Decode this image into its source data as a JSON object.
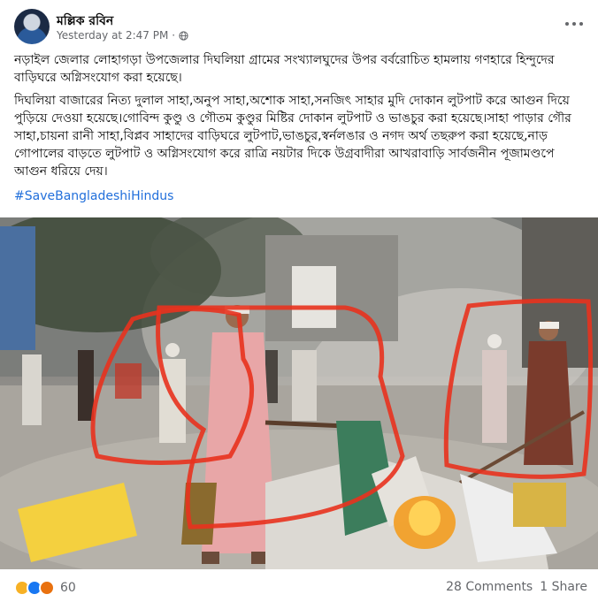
{
  "post": {
    "author": "মল্লিক রবিন",
    "timestamp": "Yesterday at 2:47 PM",
    "separator": "·",
    "privacy_icon": "globe-icon",
    "more_icon": "more-horizontal-icon",
    "paragraph_1": "নড়াইল জেলার লোহাগড়া উপজেলার দিঘলিয়া গ্রামের সংখ্যালঘুদের উপর বর্বরোচিত হামলায় গণহারে হিন্দুদের বাড়িঘরে অগ্নিসংযোগ করা হয়েছে।",
    "paragraph_2": "দিঘলিয়া বাজারের নিত্য দুলাল সাহা,অনুপ সাহা,অশোক সাহা,সনজিৎ সাহার মুদি দোকান লুটপাট করে আগুন দিয়ে পুড়িয়ে দেওয়া হয়েছে।গোবিন্দ কুণ্ডু ও গৌতম কুণ্ডুর মিষ্টির দোকান লুটপাট ও ভাঙচুর করা হয়েছে।সাহা পাড়ার গৌর সাহা,চায়না রানী সাহা,বিপ্লব সাহাদের বাড়িঘরে লুটপাট,ভাঙচুর,স্বর্নলঙার ও নগদ অর্থ তছরুপ করা হয়েছে,নাড় গোপালের বাড়তে লুটপাট ও অগ্নিসংযোগ করে রাত্রি নয়টার দিকে উগ্রবাদীরা আখরাবাড়ি সার্বজনীন পূজামণ্ডপে আগুন ধরিয়ে দেয়।",
    "hashtag": "#SaveBangladeshiHindus"
  },
  "photo": {
    "description_icon": "street-fire-photo",
    "highlight_color": "#e8321e"
  },
  "footer": {
    "reaction_icons": [
      "sad-reaction-icon",
      "like-reaction-icon",
      "angry-reaction-icon"
    ],
    "reaction_count": "60",
    "comments": "28 Comments",
    "shares": "1 Share"
  },
  "colors": {
    "link": "#216fdb",
    "secondary_text": "#65676b"
  }
}
